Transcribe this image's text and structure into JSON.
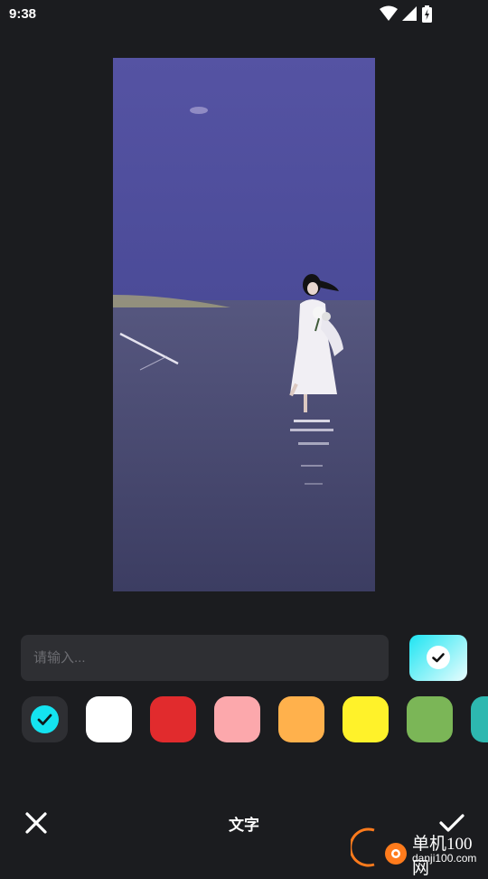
{
  "status_bar": {
    "time": "9:38",
    "icons": [
      "wifi-icon",
      "signal-icon",
      "battery-charging-icon"
    ]
  },
  "photo": {
    "description_icon": "photo-preview"
  },
  "editor": {
    "input_value": "",
    "input_placeholder": "请输入..."
  },
  "colors": {
    "accent": "#14e3f0",
    "palette": [
      "#1ee4f2",
      "#ffffff",
      "#e12b2d",
      "#fca8ac",
      "#ffb14c",
      "#fff22a",
      "#7bb657",
      "#2db8b0"
    ]
  },
  "bottom_bar": {
    "title": "文字"
  },
  "watermark": {
    "name": "单机100网",
    "url": "danji100.com"
  }
}
